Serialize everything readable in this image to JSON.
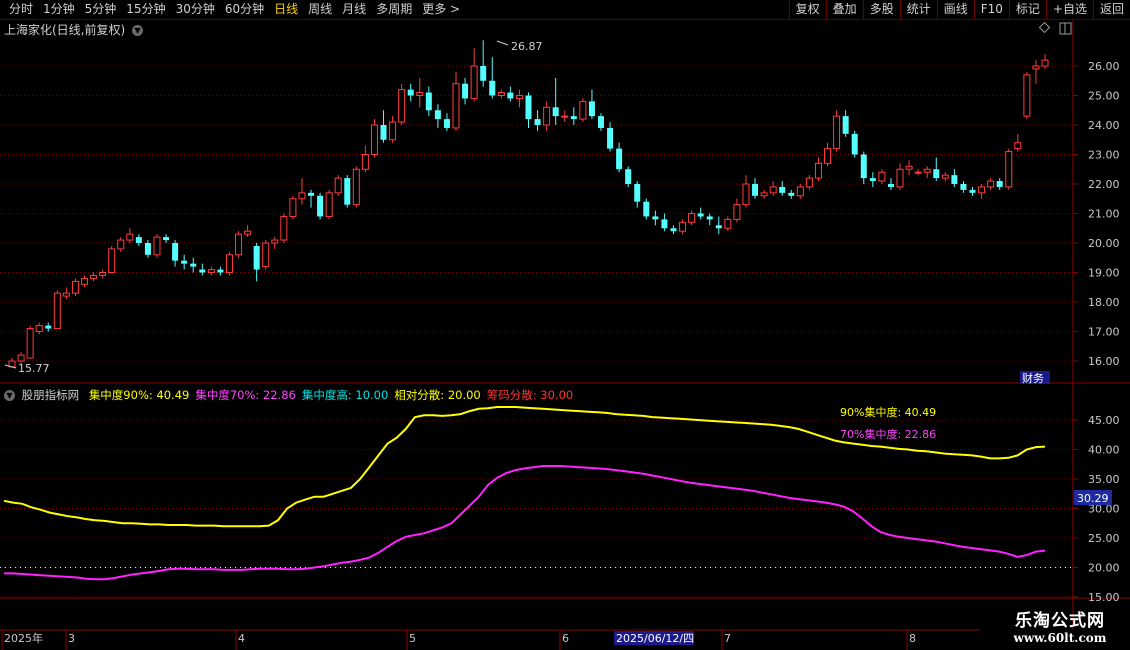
{
  "toolbar": {
    "left_items": [
      "分时",
      "1分钟",
      "5分钟",
      "15分钟",
      "30分钟",
      "60分钟",
      "日线",
      "周线",
      "月线",
      "多周期",
      "更多 >"
    ],
    "active": "日线",
    "right_items": [
      "复权",
      "叠加",
      "多股",
      "统计",
      "画线",
      "F10",
      "标记",
      "+自选",
      "返回"
    ]
  },
  "main": {
    "title": "上海家化(日线,前复权)",
    "high_label": "26.87",
    "low_label": "15.77",
    "badge": "财务",
    "y_ticks": [
      "26.00",
      "25.00",
      "24.00",
      "23.00",
      "22.00",
      "21.00",
      "20.00",
      "19.00",
      "18.00",
      "17.00",
      "16.00"
    ]
  },
  "indicator": {
    "name": "股朋指标网",
    "items": [
      {
        "label": "集中度90%: 40.49",
        "color": "#ffff00"
      },
      {
        "label": "集中度70%: 22.86",
        "color": "#ff44ff"
      },
      {
        "label": "集中度高: 10.00",
        "color": "#00e5e5"
      },
      {
        "label": "相对分散: 20.00",
        "color": "#ffff00"
      },
      {
        "label": "筹码分散: 30.00",
        "color": "#ff3333"
      }
    ],
    "legend90": "90%集中度:   40.49",
    "legend70": "70%集中度:   22.86",
    "y_ticks": [
      "45.00",
      "40.00",
      "35.00",
      "30.00",
      "25.00",
      "20.00",
      "15.00"
    ],
    "current_value": "30.29"
  },
  "xaxis": {
    "labels": [
      "2025年",
      "3",
      "4",
      "5",
      "6",
      "7",
      "8"
    ],
    "cursor_date": "2025/06/12/四"
  },
  "watermark": {
    "line1": "乐淘公式网",
    "line2": "www.60lt.com"
  },
  "colors": {
    "up": "#ff3c3c",
    "down": "#54ffff",
    "c90": "#ffff00",
    "c70": "#ff22ff",
    "grid": "#7a0000"
  },
  "chart_data": {
    "type": "candlestick",
    "candles": [
      [
        15.8,
        16.1,
        15.77,
        16.0
      ],
      [
        16.0,
        16.3,
        15.9,
        16.2
      ],
      [
        16.1,
        17.2,
        16.1,
        17.1
      ],
      [
        17.0,
        17.3,
        16.9,
        17.2
      ],
      [
        17.2,
        17.3,
        17.0,
        17.1
      ],
      [
        17.1,
        18.4,
        17.1,
        18.3
      ],
      [
        18.2,
        18.5,
        18.1,
        18.3
      ],
      [
        18.3,
        18.8,
        18.2,
        18.7
      ],
      [
        18.6,
        18.9,
        18.5,
        18.8
      ],
      [
        18.8,
        19.0,
        18.7,
        18.9
      ],
      [
        18.9,
        19.1,
        18.8,
        19.0
      ],
      [
        19.0,
        19.9,
        19.0,
        19.8
      ],
      [
        19.8,
        20.2,
        19.7,
        20.1
      ],
      [
        20.1,
        20.5,
        20.0,
        20.3
      ],
      [
        20.2,
        20.3,
        19.9,
        20.0
      ],
      [
        20.0,
        20.1,
        19.5,
        19.6
      ],
      [
        19.6,
        20.3,
        19.5,
        20.2
      ],
      [
        20.2,
        20.3,
        20.0,
        20.1
      ],
      [
        20.0,
        20.1,
        19.2,
        19.4
      ],
      [
        19.4,
        19.6,
        19.1,
        19.3
      ],
      [
        19.3,
        19.5,
        19.0,
        19.2
      ],
      [
        19.1,
        19.3,
        18.9,
        19.0
      ],
      [
        19.0,
        19.2,
        18.9,
        19.1
      ],
      [
        19.1,
        19.2,
        18.9,
        19.0
      ],
      [
        19.0,
        19.7,
        18.9,
        19.6
      ],
      [
        19.6,
        20.4,
        19.5,
        20.3
      ],
      [
        20.3,
        20.6,
        20.2,
        20.4
      ],
      [
        19.9,
        20.0,
        18.7,
        19.1
      ],
      [
        19.2,
        20.1,
        19.1,
        20.0
      ],
      [
        20.0,
        20.2,
        19.8,
        20.1
      ],
      [
        20.1,
        21.0,
        20.0,
        20.9
      ],
      [
        20.9,
        21.6,
        20.8,
        21.5
      ],
      [
        21.5,
        22.2,
        21.3,
        21.7
      ],
      [
        21.7,
        21.8,
        21.2,
        21.6
      ],
      [
        21.6,
        21.7,
        20.8,
        20.9
      ],
      [
        20.9,
        21.8,
        20.8,
        21.7
      ],
      [
        21.7,
        22.3,
        21.6,
        22.2
      ],
      [
        22.2,
        22.3,
        21.2,
        21.3
      ],
      [
        21.3,
        22.6,
        21.2,
        22.5
      ],
      [
        22.5,
        23.3,
        22.4,
        23.0
      ],
      [
        23.0,
        24.2,
        22.9,
        24.0
      ],
      [
        24.0,
        24.5,
        23.4,
        23.5
      ],
      [
        23.5,
        24.3,
        23.4,
        24.1
      ],
      [
        24.1,
        25.4,
        24.0,
        25.2
      ],
      [
        25.2,
        25.4,
        24.8,
        25.0
      ],
      [
        25.0,
        25.6,
        24.6,
        25.1
      ],
      [
        25.1,
        25.3,
        24.3,
        24.5
      ],
      [
        24.5,
        24.7,
        23.9,
        24.2
      ],
      [
        24.2,
        24.4,
        23.8,
        23.9
      ],
      [
        23.9,
        25.8,
        23.8,
        25.4
      ],
      [
        25.4,
        25.6,
        24.7,
        24.9
      ],
      [
        24.9,
        26.6,
        24.8,
        26.0
      ],
      [
        26.0,
        26.87,
        25.3,
        25.5
      ],
      [
        25.5,
        26.3,
        24.9,
        25.0
      ],
      [
        25.0,
        25.2,
        24.9,
        25.1
      ],
      [
        25.1,
        25.3,
        24.8,
        24.9
      ],
      [
        24.9,
        25.2,
        24.6,
        25.0
      ],
      [
        25.0,
        25.1,
        23.9,
        24.2
      ],
      [
        24.2,
        24.5,
        23.8,
        24.0
      ],
      [
        24.0,
        24.8,
        23.8,
        24.6
      ],
      [
        24.6,
        25.6,
        24.0,
        24.3
      ],
      [
        24.3,
        24.5,
        24.1,
        24.3
      ],
      [
        24.3,
        24.6,
        24.0,
        24.2
      ],
      [
        24.2,
        24.9,
        24.1,
        24.8
      ],
      [
        24.8,
        25.2,
        24.2,
        24.3
      ],
      [
        24.3,
        24.4,
        23.8,
        23.9
      ],
      [
        23.9,
        24.1,
        23.1,
        23.2
      ],
      [
        23.2,
        23.4,
        22.4,
        22.5
      ],
      [
        22.5,
        22.6,
        21.9,
        22.0
      ],
      [
        22.0,
        22.1,
        21.2,
        21.4
      ],
      [
        21.4,
        21.5,
        20.8,
        20.9
      ],
      [
        20.9,
        21.1,
        20.6,
        20.8
      ],
      [
        20.8,
        21.0,
        20.4,
        20.5
      ],
      [
        20.5,
        20.6,
        20.3,
        20.4
      ],
      [
        20.4,
        20.8,
        20.3,
        20.7
      ],
      [
        20.7,
        21.1,
        20.6,
        21.0
      ],
      [
        21.0,
        21.2,
        20.8,
        20.9
      ],
      [
        20.9,
        21.0,
        20.6,
        20.8
      ],
      [
        20.6,
        20.9,
        20.3,
        20.5
      ],
      [
        20.5,
        20.9,
        20.4,
        20.8
      ],
      [
        20.8,
        21.5,
        20.7,
        21.3
      ],
      [
        21.3,
        22.3,
        21.2,
        22.0
      ],
      [
        22.0,
        22.2,
        21.5,
        21.6
      ],
      [
        21.6,
        21.8,
        21.5,
        21.7
      ],
      [
        21.7,
        22.1,
        21.6,
        21.9
      ],
      [
        21.9,
        22.1,
        21.6,
        21.7
      ],
      [
        21.7,
        21.8,
        21.5,
        21.6
      ],
      [
        21.6,
        22.0,
        21.5,
        21.9
      ],
      [
        21.9,
        22.3,
        21.8,
        22.2
      ],
      [
        22.2,
        22.9,
        22.1,
        22.7
      ],
      [
        22.7,
        23.4,
        22.6,
        23.2
      ],
      [
        23.2,
        24.5,
        23.1,
        24.3
      ],
      [
        24.3,
        24.5,
        23.6,
        23.7
      ],
      [
        23.7,
        23.8,
        22.9,
        23.0
      ],
      [
        23.0,
        23.1,
        22.0,
        22.2
      ],
      [
        22.2,
        22.4,
        21.9,
        22.1
      ],
      [
        22.1,
        22.5,
        22.0,
        22.4
      ],
      [
        22.0,
        22.2,
        21.8,
        21.9
      ],
      [
        21.9,
        22.7,
        21.8,
        22.5
      ],
      [
        22.5,
        22.8,
        22.3,
        22.6
      ],
      [
        22.4,
        22.5,
        22.3,
        22.4
      ],
      [
        22.4,
        22.6,
        22.2,
        22.5
      ],
      [
        22.5,
        22.9,
        22.1,
        22.2
      ],
      [
        22.2,
        22.4,
        22.1,
        22.3
      ],
      [
        22.3,
        22.5,
        21.9,
        22.0
      ],
      [
        22.0,
        22.1,
        21.7,
        21.8
      ],
      [
        21.8,
        21.9,
        21.6,
        21.7
      ],
      [
        21.7,
        22.0,
        21.5,
        21.9
      ],
      [
        21.9,
        22.2,
        21.8,
        22.1
      ],
      [
        22.1,
        22.2,
        21.8,
        21.9
      ],
      [
        21.9,
        23.2,
        21.8,
        23.1
      ],
      [
        23.2,
        23.7,
        23.1,
        23.4
      ],
      [
        24.3,
        25.8,
        24.2,
        25.7
      ],
      [
        25.9,
        26.2,
        25.4,
        26.0
      ],
      [
        26.0,
        26.4,
        25.9,
        26.2
      ]
    ],
    "concentration_90": [
      31.3,
      31.0,
      30.8,
      30.2,
      29.8,
      29.3,
      29.0,
      28.7,
      28.5,
      28.2,
      28.0,
      27.9,
      27.7,
      27.5,
      27.5,
      27.4,
      27.3,
      27.3,
      27.2,
      27.2,
      27.2,
      27.1,
      27.1,
      27.1,
      27.0,
      27.0,
      27.0,
      27.0,
      27.0,
      27.1,
      28.0,
      30.0,
      31.0,
      31.5,
      32.0,
      32.0,
      32.5,
      33.0,
      33.5,
      35.0,
      37.0,
      39.0,
      41.0,
      42.0,
      43.5,
      45.5,
      45.8,
      45.8,
      45.7,
      45.8,
      46.0,
      46.5,
      46.9,
      47.0,
      47.2,
      47.2,
      47.2,
      47.1,
      47.0,
      46.9,
      46.8,
      46.7,
      46.6,
      46.5,
      46.4,
      46.3,
      46.2,
      46.0,
      45.9,
      45.8,
      45.7,
      45.5,
      45.4,
      45.3,
      45.2,
      45.1,
      45.0,
      44.9,
      44.8,
      44.7,
      44.6,
      44.5,
      44.4,
      44.3,
      44.2,
      44.0,
      43.8,
      43.5,
      43.0,
      42.5,
      42.0,
      41.5,
      41.2,
      41.0,
      40.8,
      40.6,
      40.5,
      40.3,
      40.1,
      40.0,
      39.8,
      39.7,
      39.5,
      39.3,
      39.2,
      39.1,
      39.0,
      38.8,
      38.5,
      38.5,
      38.6,
      39.0,
      40.0,
      40.4,
      40.49
    ],
    "concentration_70": [
      19.0,
      19.0,
      18.9,
      18.8,
      18.7,
      18.6,
      18.5,
      18.4,
      18.3,
      18.1,
      18.0,
      18.0,
      18.2,
      18.5,
      18.8,
      19.0,
      19.2,
      19.4,
      19.7,
      19.8,
      19.8,
      19.7,
      19.7,
      19.7,
      19.6,
      19.6,
      19.6,
      19.7,
      19.8,
      19.8,
      19.8,
      19.7,
      19.7,
      19.8,
      20.0,
      20.2,
      20.5,
      20.8,
      21.0,
      21.3,
      21.7,
      22.5,
      23.5,
      24.5,
      25.2,
      25.5,
      25.8,
      26.3,
      26.8,
      27.5,
      29.0,
      30.5,
      32.0,
      34.0,
      35.2,
      36.0,
      36.5,
      36.8,
      37.0,
      37.2,
      37.2,
      37.2,
      37.1,
      37.0,
      36.9,
      36.8,
      36.7,
      36.5,
      36.3,
      36.1,
      35.9,
      35.6,
      35.3,
      35.0,
      34.7,
      34.4,
      34.2,
      34.0,
      33.8,
      33.6,
      33.4,
      33.2,
      33.0,
      32.7,
      32.4,
      32.1,
      31.8,
      31.6,
      31.4,
      31.2,
      31.0,
      30.7,
      30.3,
      29.5,
      28.3,
      27.0,
      26.0,
      25.5,
      25.2,
      25.0,
      24.8,
      24.6,
      24.4,
      24.1,
      23.8,
      23.5,
      23.3,
      23.1,
      22.9,
      22.7,
      22.3,
      21.8,
      22.1,
      22.7,
      22.86
    ],
    "levels": {
      "high": 10.0,
      "relative_disperse": 20.0,
      "disperse": 30.0
    },
    "main_ylim": [
      15.5,
      26.9
    ],
    "ind_ylim": [
      12.8,
      48.8
    ]
  }
}
